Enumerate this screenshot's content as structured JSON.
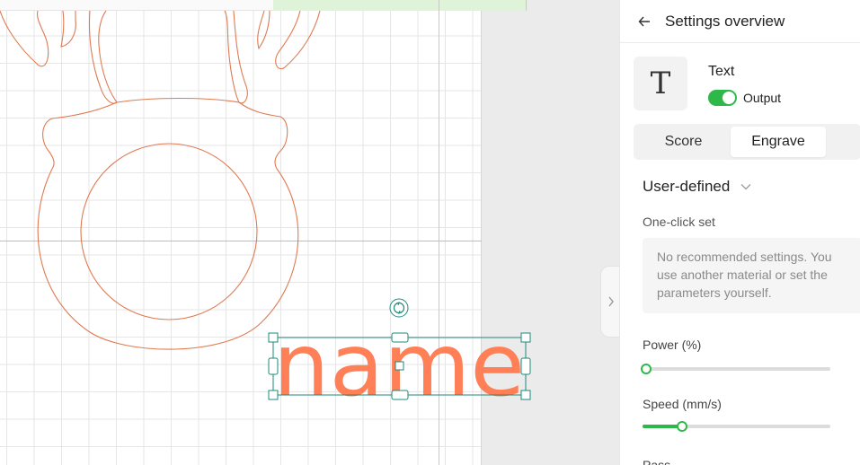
{
  "canvas": {
    "text_object": "name",
    "colors": {
      "artwork": "#e07a52",
      "selection": "#1e8a7a",
      "text_fill": "#ff7f56"
    }
  },
  "panel": {
    "title": "Settings overview",
    "layer": {
      "icon_glyph": "T",
      "name": "Text",
      "output_label": "Output",
      "output_enabled": true
    },
    "tabs": [
      {
        "label": "Score",
        "active": false
      },
      {
        "label": "Engrave",
        "active": true
      }
    ],
    "preset": {
      "label": "User-defined"
    },
    "one_click": {
      "label": "One-click set",
      "notice": "No recommended settings. You use another material or set the parameters yourself."
    },
    "power": {
      "label": "Power (%)",
      "level": 0.02
    },
    "speed": {
      "label": "Speed (mm/s)",
      "level": 0.21
    },
    "passes": {
      "label": "Pass"
    },
    "colors": {
      "accent": "#2fb84a"
    }
  }
}
